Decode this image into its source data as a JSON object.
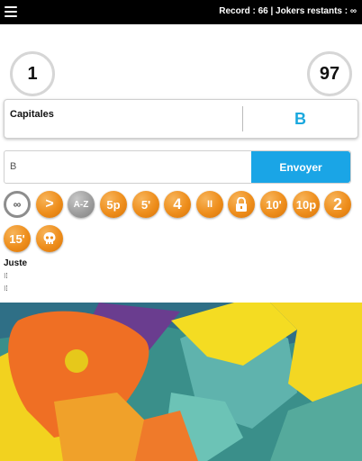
{
  "header": {
    "record_text": "Record : 66 | Jokers restants : ∞"
  },
  "scores": {
    "left": "1",
    "right": "97"
  },
  "category": {
    "label": "Capitales",
    "letter": "B"
  },
  "answer": {
    "value": "B",
    "send_label": "Envoyer"
  },
  "jokers": [
    {
      "name": "infinite-joker",
      "label": "∞"
    },
    {
      "name": "skip-joker",
      "label": ">"
    },
    {
      "name": "az-joker",
      "label": "A-Z"
    },
    {
      "name": "5p-joker",
      "label": "5p"
    },
    {
      "name": "5-min-joker",
      "label": "5'"
    },
    {
      "name": "4-joker",
      "label": "4"
    },
    {
      "name": "pause-joker",
      "label": "II"
    },
    {
      "name": "lock-joker",
      "label": ""
    },
    {
      "name": "10-min-joker",
      "label": "10'"
    },
    {
      "name": "10p-joker",
      "label": "10p"
    },
    {
      "name": "2-joker",
      "label": "2"
    },
    {
      "name": "15-min-joker",
      "label": "15'"
    },
    {
      "name": "skull-joker",
      "label": ""
    }
  ],
  "result": {
    "label": "Juste"
  },
  "colors": {
    "accent": "#1aa5e6",
    "joker_orange": "#ee8e1c",
    "letter_blue": "#1aa8de"
  }
}
